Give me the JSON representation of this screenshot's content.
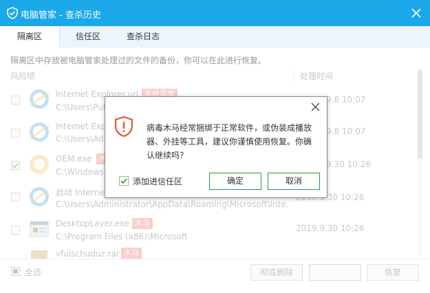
{
  "window": {
    "title": "电脑管家 - 查杀历史"
  },
  "tabs": [
    {
      "label": "隔离区",
      "active": true
    },
    {
      "label": "信任区",
      "active": false
    },
    {
      "label": "查杀日志",
      "active": false
    }
  ],
  "description": "隔离区中存放被电脑管家处理过的文件的备份，你可以在此进行恢复。",
  "table": {
    "col_risk": "风险项",
    "col_time": "处理时间",
    "rows": [
      {
        "name": "Internet Explorer.url",
        "path": "C:\\Users\\Pub",
        "tag": "系统异常",
        "time": "9.8 10:07",
        "checked": false,
        "icon": "internet-explorer-icon"
      },
      {
        "name": "Internet Expl",
        "path": "C:\\Users\\Adi",
        "tag": "",
        "time": "9.8 10:07",
        "checked": false,
        "icon": "internet-explorer-icon"
      },
      {
        "name": "OEM.exe",
        "path": "C:\\Windows",
        "tag": "木",
        "time": "9.30 10:26",
        "checked": true,
        "icon": "oem-exe-icon"
      },
      {
        "name": "启动 Internet",
        "path": "C:\\Users\\Administrator\\AppData\\Roaming\\Microsoft\\Inte...",
        "tag": "",
        "time": "2019.9.30 10:26",
        "checked": false,
        "icon": "internet-explorer-icon"
      },
      {
        "name": "DesktopLayer.exe",
        "path": "C:\\Program Files (x86)\\Microsoft",
        "tag": "木马",
        "time": "2019.9.30 10:26",
        "checked": false,
        "icon": "application-window-icon"
      },
      {
        "name": "vfuischuduz.rar",
        "path": "",
        "tag": "木马",
        "time": "",
        "checked": false,
        "icon": "archive-icon"
      }
    ]
  },
  "footer": {
    "select_all": "全选",
    "delete_button": "彻底删除",
    "trust_button": "",
    "restore_button": "恢复"
  },
  "dialog": {
    "message": "病毒木马经常捆绑于正常软件，或伪装成播放器、外挂等工具，建议你谨慎使用恢复。你确认继续吗？",
    "checkbox_label": "添加进信任区",
    "checkbox_checked": true,
    "ok_button": "确定",
    "cancel_button": "取消"
  },
  "colors": {
    "titlebar": "#1aa8e8",
    "accent_green": "#1e9c3d",
    "warning_orange": "#e8542a",
    "tag_red": "#f4a7a0"
  }
}
